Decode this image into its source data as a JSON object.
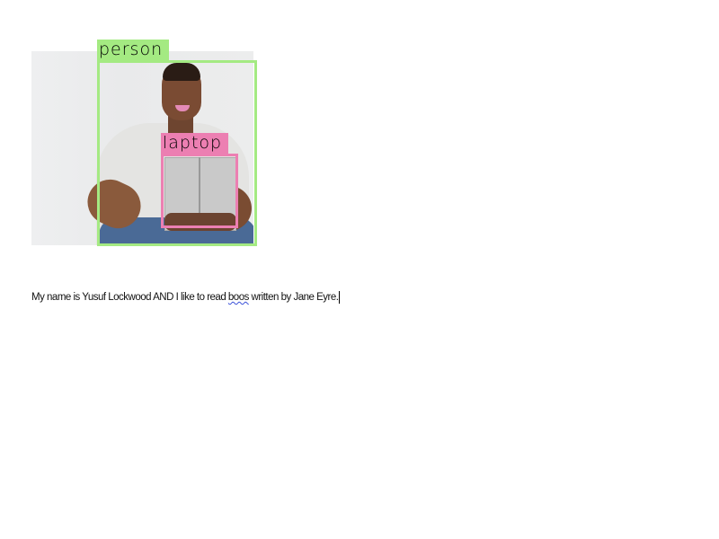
{
  "detections": [
    {
      "label": "person",
      "color": "#a4ea82"
    },
    {
      "label": "laptop",
      "color": "#ec7fb2"
    }
  ],
  "document": {
    "text_before": "My name is Yusuf Lockwood  AND I like to read ",
    "misspelled_word": "boos",
    "text_after": " written by Jane Eyre."
  }
}
